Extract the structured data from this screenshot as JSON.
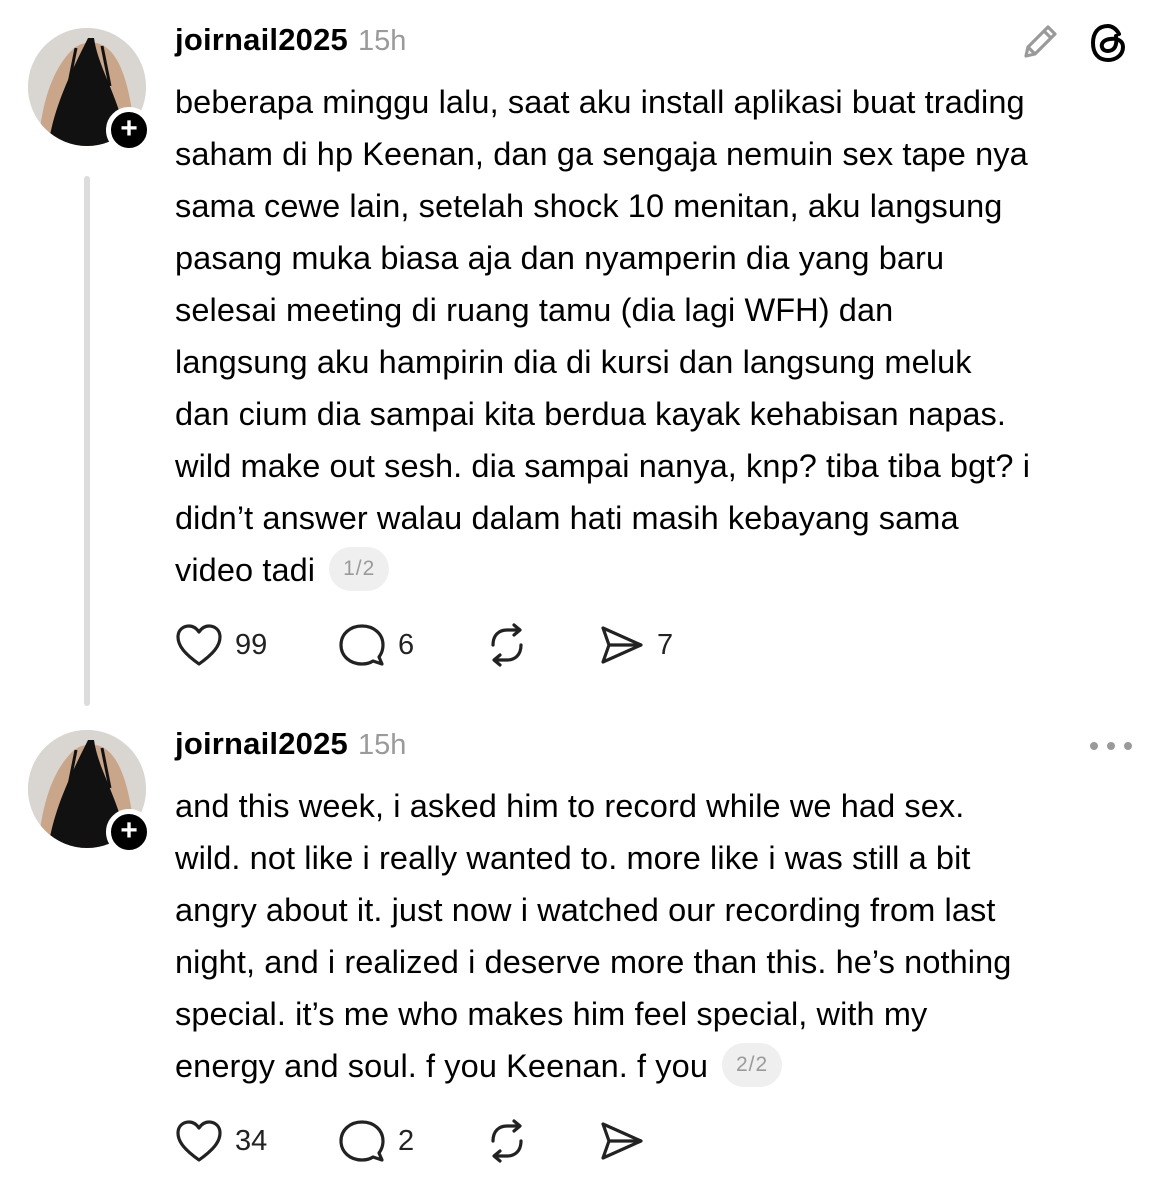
{
  "posts": [
    {
      "username": "joirnail2025",
      "time": "15h",
      "lines": [
        "beberapa minggu lalu, saat aku install aplikasi buat trading",
        "saham di hp Keenan, dan ga sengaja nemuin sex tape nya",
        "sama cewe lain, setelah shock 10 menitan, aku langsung",
        "pasang muka biasa aja dan nyamperin dia yang baru",
        "selesai meeting di ruang tamu (dia lagi WFH) dan",
        "langsung aku hampirin dia di kursi dan langsung meluk",
        "dan cium dia sampai kita berdua kayak kehabisan napas.",
        "wild make out sesh. dia sampai nanya, knp? tiba tiba bgt? i",
        "didn’t answer walau dalam hati masih kebayang sama"
      ],
      "last_line": "video tadi",
      "pager": "1/2",
      "likes": "99",
      "replies": "6",
      "shares": "7",
      "top_icons": [
        "pencil-icon",
        "threads-logo-icon"
      ]
    },
    {
      "username": "joirnail2025",
      "time": "15h",
      "lines": [
        "and this week, i asked him to record while we had sex.",
        "wild. not like i really wanted to. more like i was still a bit",
        "angry about it. just now i watched our recording from last",
        "night, and i realized i deserve more than this. he’s nothing",
        "special. it’s me who makes him feel special, with my"
      ],
      "last_line": "energy and soul. f you Keenan. f you",
      "pager": "2/2",
      "likes": "34",
      "replies": "2",
      "top_icons": [
        "more-options-icon"
      ]
    }
  ],
  "colors": {
    "text": "#000000",
    "muted": "#9a9a9a",
    "thread_line": "#dcdcdc",
    "pager_bg": "#efefef"
  }
}
